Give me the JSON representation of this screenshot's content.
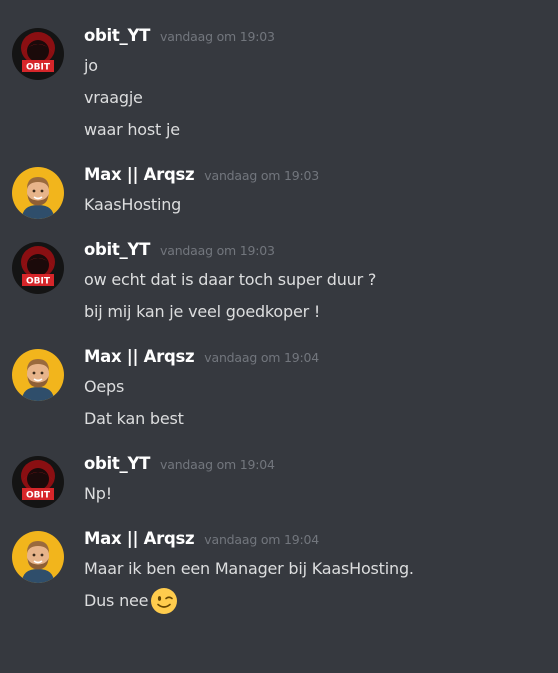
{
  "messages": [
    {
      "author": "obit_YT",
      "avatar_icon": "obit-avatar-icon",
      "timestamp": "vandaag om 19:03",
      "lines": [
        "jo",
        "vraagje",
        "waar host je"
      ]
    },
    {
      "author": "Max || Arqsz",
      "avatar_icon": "max-avatar-icon",
      "timestamp": "vandaag om 19:03",
      "lines": [
        "KaasHosting"
      ]
    },
    {
      "author": "obit_YT",
      "avatar_icon": "obit-avatar-icon",
      "timestamp": "vandaag om 19:03",
      "lines": [
        "ow echt dat is daar toch super duur ?",
        "bij mij kan je veel goedkoper !"
      ]
    },
    {
      "author": "Max || Arqsz",
      "avatar_icon": "max-avatar-icon",
      "timestamp": "vandaag om 19:04",
      "lines": [
        "Oeps",
        "Dat kan best"
      ]
    },
    {
      "author": "obit_YT",
      "avatar_icon": "obit-avatar-icon",
      "timestamp": "vandaag om 19:04",
      "lines": [
        "Np!"
      ]
    },
    {
      "author": "Max || Arqsz",
      "avatar_icon": "max-avatar-icon",
      "timestamp": "vandaag om 19:04",
      "lines": [
        "Maar ik ben een Manager bij KaasHosting.",
        "Dus nee"
      ],
      "emoji": "winking-face-emoji-icon"
    }
  ],
  "obit_avatar_text": "OBIT",
  "colors": {
    "background": "#36393f",
    "author": "#ffffff",
    "timestamp": "#72767d",
    "message_text": "#dcddde"
  }
}
